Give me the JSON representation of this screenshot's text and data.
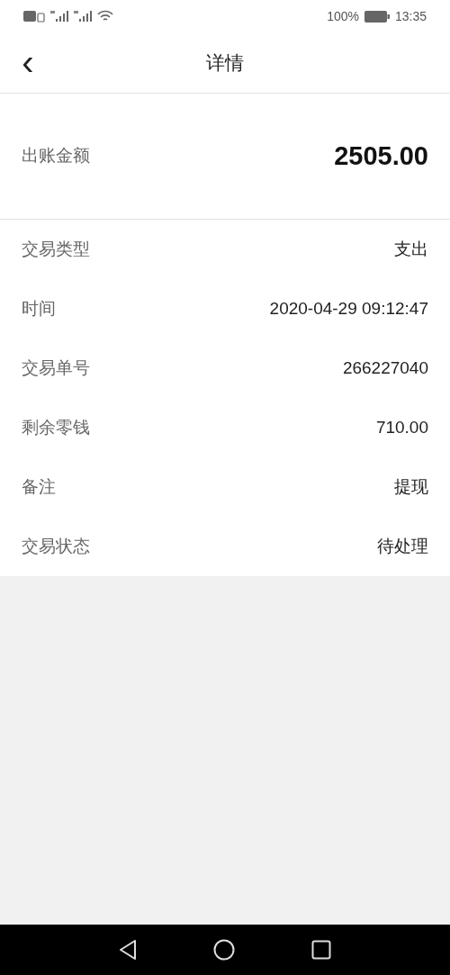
{
  "status_bar": {
    "battery_text": "100%",
    "time": "13:35"
  },
  "header": {
    "back": "‹",
    "title": "详情"
  },
  "amount": {
    "label": "出账金额",
    "value": "2505.00"
  },
  "rows": [
    {
      "label": "交易类型",
      "value": "支出"
    },
    {
      "label": "时间",
      "value": "2020-04-29 09:12:47"
    },
    {
      "label": "交易单号",
      "value": "266227040"
    },
    {
      "label": "剩余零钱",
      "value": "710.00"
    },
    {
      "label": "备注",
      "value": "提现"
    },
    {
      "label": "交易状态",
      "value": "待处理"
    }
  ]
}
